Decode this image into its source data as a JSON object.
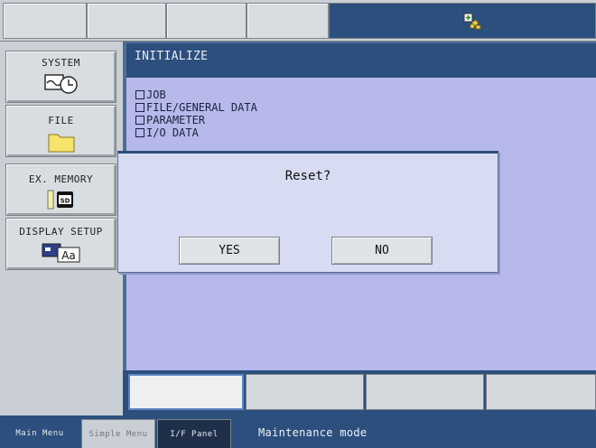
{
  "toolbar": {
    "status_icon": "robot-status-icon"
  },
  "menu": {
    "items": [
      {
        "label": "SYSTEM",
        "icon": "system-clock-icon"
      },
      {
        "label": "FILE",
        "icon": "folder-icon"
      },
      {
        "label": "EX. MEMORY",
        "icon": "sd-card-icon"
      },
      {
        "label": "DISPLAY SETUP",
        "icon": "display-font-icon"
      }
    ]
  },
  "main": {
    "title": "INITIALIZE",
    "items": [
      "JOB",
      "FILE/GENERAL DATA",
      "PARAMETER",
      "I/O DATA"
    ]
  },
  "dialog": {
    "message": "Reset?",
    "yes_label": "YES",
    "no_label": "NO"
  },
  "status_bar": {
    "tabs": [
      "Main Menu",
      "Simple Menu",
      "I/F Panel"
    ],
    "mode_text": "Maintenance mode"
  },
  "colors": {
    "navy": "#2c4f7d",
    "panel": "#b6b9ea",
    "dialog": "#d7dcf3"
  }
}
